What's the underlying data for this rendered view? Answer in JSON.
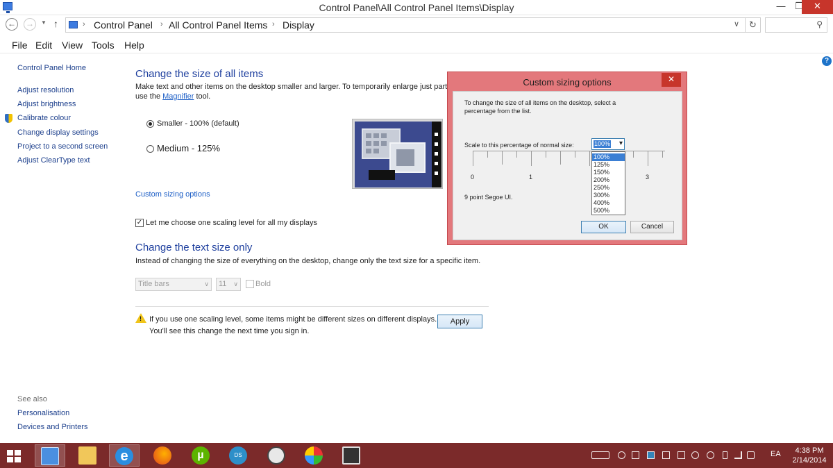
{
  "window": {
    "title": "Control Panel\\All Control Panel Items\\Display",
    "minimize": "—",
    "maximize": "❐",
    "close": "✕"
  },
  "address": {
    "crumbs": [
      "Control Panel",
      "All Control Panel Items",
      "Display"
    ],
    "search_placeholder": ""
  },
  "menu": [
    "File",
    "Edit",
    "View",
    "Tools",
    "Help"
  ],
  "sidebar": {
    "home": "Control Panel Home",
    "items": [
      "Adjust resolution",
      "Adjust brightness",
      "Calibrate colour",
      "Change display settings",
      "Project to a second screen",
      "Adjust ClearType text"
    ],
    "see_also_title": "See also",
    "see_also": [
      "Personalisation",
      "Devices and Printers"
    ]
  },
  "main": {
    "section1_title": "Change the size of all items",
    "section1_desc_a": "Make text and other items on the desktop smaller and larger. To temporarily enlarge just part of th",
    "section1_desc_b_pre": "use the ",
    "section1_desc_b_link": "Magnifier",
    "section1_desc_b_post": " tool.",
    "options": [
      {
        "label": "Smaller - 100% (default)",
        "selected": true
      },
      {
        "label": "Medium - 125%",
        "selected": false
      }
    ],
    "custom_link": "Custom sizing options",
    "scaling_checkbox": "Let me choose one scaling level for all my displays",
    "scaling_checked": true,
    "section2_title": "Change the text size only",
    "section2_desc": "Instead of changing the size of everything on the desktop, change only the text size for a specific item.",
    "item_select": "Title bars",
    "size_select": "11",
    "bold_label": "Bold",
    "warning_line1": "If you use one scaling level, some items might be different sizes on different displays.",
    "warning_line2": "You'll see this change the next time you sign in.",
    "apply": "Apply"
  },
  "dialog": {
    "title": "Custom sizing options",
    "close": "✕",
    "desc_line1": "To change the size of all items on the desktop, select a",
    "desc_line2": "percentage from the list.",
    "scale_label": "Scale to this percentage of normal size:",
    "scale_value": "100%",
    "options": [
      "100%",
      "125%",
      "150%",
      "200%",
      "250%",
      "300%",
      "400%",
      "500%"
    ],
    "selected_index": 0,
    "ruler_labels": [
      "0",
      "1",
      "3"
    ],
    "font_sample": "9 point Segoe UI.",
    "ok": "OK",
    "cancel": "Cancel"
  },
  "taskbar": {
    "apps": [
      "control-panel",
      "file-explorer",
      "internet-explorer",
      "firefox",
      "utorrent",
      "ds-app",
      "game-app",
      "paint-app",
      "screen-app"
    ],
    "language": "EA",
    "time": "4:38 PM",
    "date": "2/14/2014"
  }
}
